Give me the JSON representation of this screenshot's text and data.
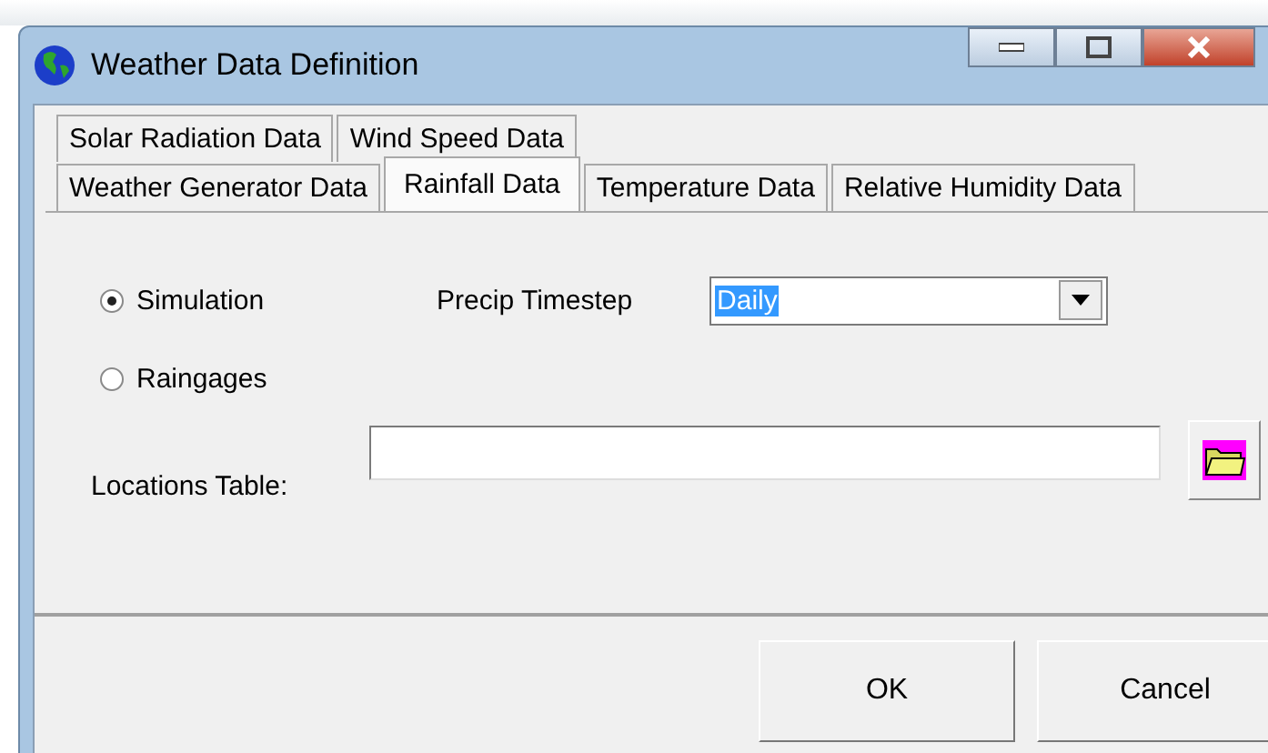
{
  "window": {
    "title": "Weather Data Definition"
  },
  "tab_rows": [
    [
      {
        "label": "Solar Radiation Data",
        "selected": false
      },
      {
        "label": "Wind Speed Data",
        "selected": false
      }
    ],
    [
      {
        "label": "Weather Generator Data",
        "selected": false
      },
      {
        "label": "Rainfall Data",
        "selected": true
      },
      {
        "label": "Temperature Data",
        "selected": false
      },
      {
        "label": "Relative Humidity Data",
        "selected": false
      }
    ]
  ],
  "source_options": [
    {
      "label": "Simulation",
      "selected": true
    },
    {
      "label": "Raingages",
      "selected": false
    }
  ],
  "precip_timestep": {
    "label": "Precip Timestep",
    "value": "Daily"
  },
  "locations_table": {
    "label": "Locations Table:"
  },
  "buttons": [
    "OK",
    "Cancel"
  ]
}
